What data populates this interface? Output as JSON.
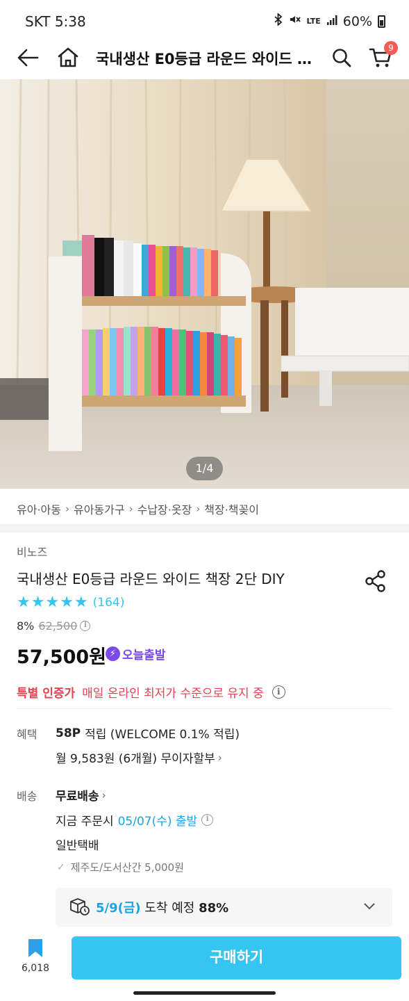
{
  "status_bar": {
    "carrier_time": "SKT 5:38",
    "network": "LTE",
    "battery": "60%"
  },
  "top_nav": {
    "title": "국내생산 E0등급 라운드 와이드 책장 2단 DIY",
    "cart_count": "9",
    "icons": [
      "back-arrow-icon",
      "home-icon",
      "search-icon",
      "cart-icon"
    ]
  },
  "gallery": {
    "counter": "1/4"
  },
  "breadcrumb": [
    "유아·아동",
    "유아동가구",
    "수납장·옷장",
    "책장·책꽂이"
  ],
  "product": {
    "brand": "비노즈",
    "title": "국내생산 E0등급 라운드 와이드 책장 2단 DIY",
    "rating_stars": 5,
    "review_count": "(164)",
    "discount_pct": "8%",
    "original_price": "62,500",
    "price": "57,500원",
    "today_ship_badge": "오늘출발"
  },
  "certified": {
    "label": "특별 인증가",
    "text": "매일 온라인 최저가 수준으로 유지 중"
  },
  "benefit": {
    "label": "혜택",
    "points_bold": "58P",
    "points_text": "적립 (WELCOME 0.1% 적립)",
    "installment": "월 9,583원 (6개월) 무이자할부"
  },
  "shipping": {
    "label": "배송",
    "free": "무료배송",
    "order_prefix": "지금 주문시",
    "ship_date": "05/07(수) 출발",
    "method": "일반택배",
    "extra_fee": "제주도/도서산간 5,000원"
  },
  "arrival": {
    "date": "5/9(금)",
    "text": "도착 예정",
    "rate": "88%"
  },
  "bottom": {
    "scrap_count": "6,018",
    "buy_label": "구매하기"
  }
}
